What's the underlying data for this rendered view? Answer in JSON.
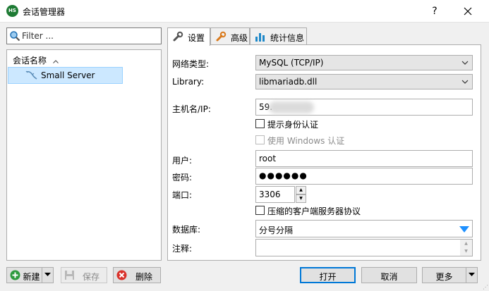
{
  "window": {
    "title": "会话管理器",
    "help": "?",
    "close": "✕"
  },
  "sidebar": {
    "filter_placeholder": "Filter ...",
    "tree_header": "会话名称",
    "sort_caret": "^",
    "sessions": [
      {
        "name": "Small Server",
        "selected": true
      }
    ]
  },
  "tabs": [
    {
      "label": "设置",
      "icon": "wrench-icon",
      "active": true
    },
    {
      "label": "高级",
      "icon": "wrench-icon",
      "active": false
    },
    {
      "label": "统计信息",
      "icon": "bar-chart-icon",
      "active": false
    }
  ],
  "settings": {
    "network_type_label": "网络类型:",
    "network_type_value": "MySQL (TCP/IP)",
    "library_label": "Library:",
    "library_value": "libmariadb.dll",
    "host_label": "主机名/IP:",
    "host_value": "59.",
    "prompt_credentials_label": "提示身份认证",
    "windows_auth_label": "使用 Windows 认证",
    "user_label": "用户:",
    "user_value": "root",
    "password_label": "密码:",
    "password_value": "●●●●●●",
    "port_label": "端口:",
    "port_value": "3306",
    "compress_label": "压缩的客户端服务器协议",
    "database_label": "数据库:",
    "database_value": "分号分隔",
    "comment_label": "注释:"
  },
  "buttons": {
    "new": "新建",
    "save": "保存",
    "delete": "删除",
    "open": "打开",
    "cancel": "取消",
    "more": "更多"
  },
  "colors": {
    "accent": "#0078d7",
    "selection": "#cce8ff",
    "dropdown_arrow": "#1e90ff",
    "app_icon": "#1e7b34"
  }
}
